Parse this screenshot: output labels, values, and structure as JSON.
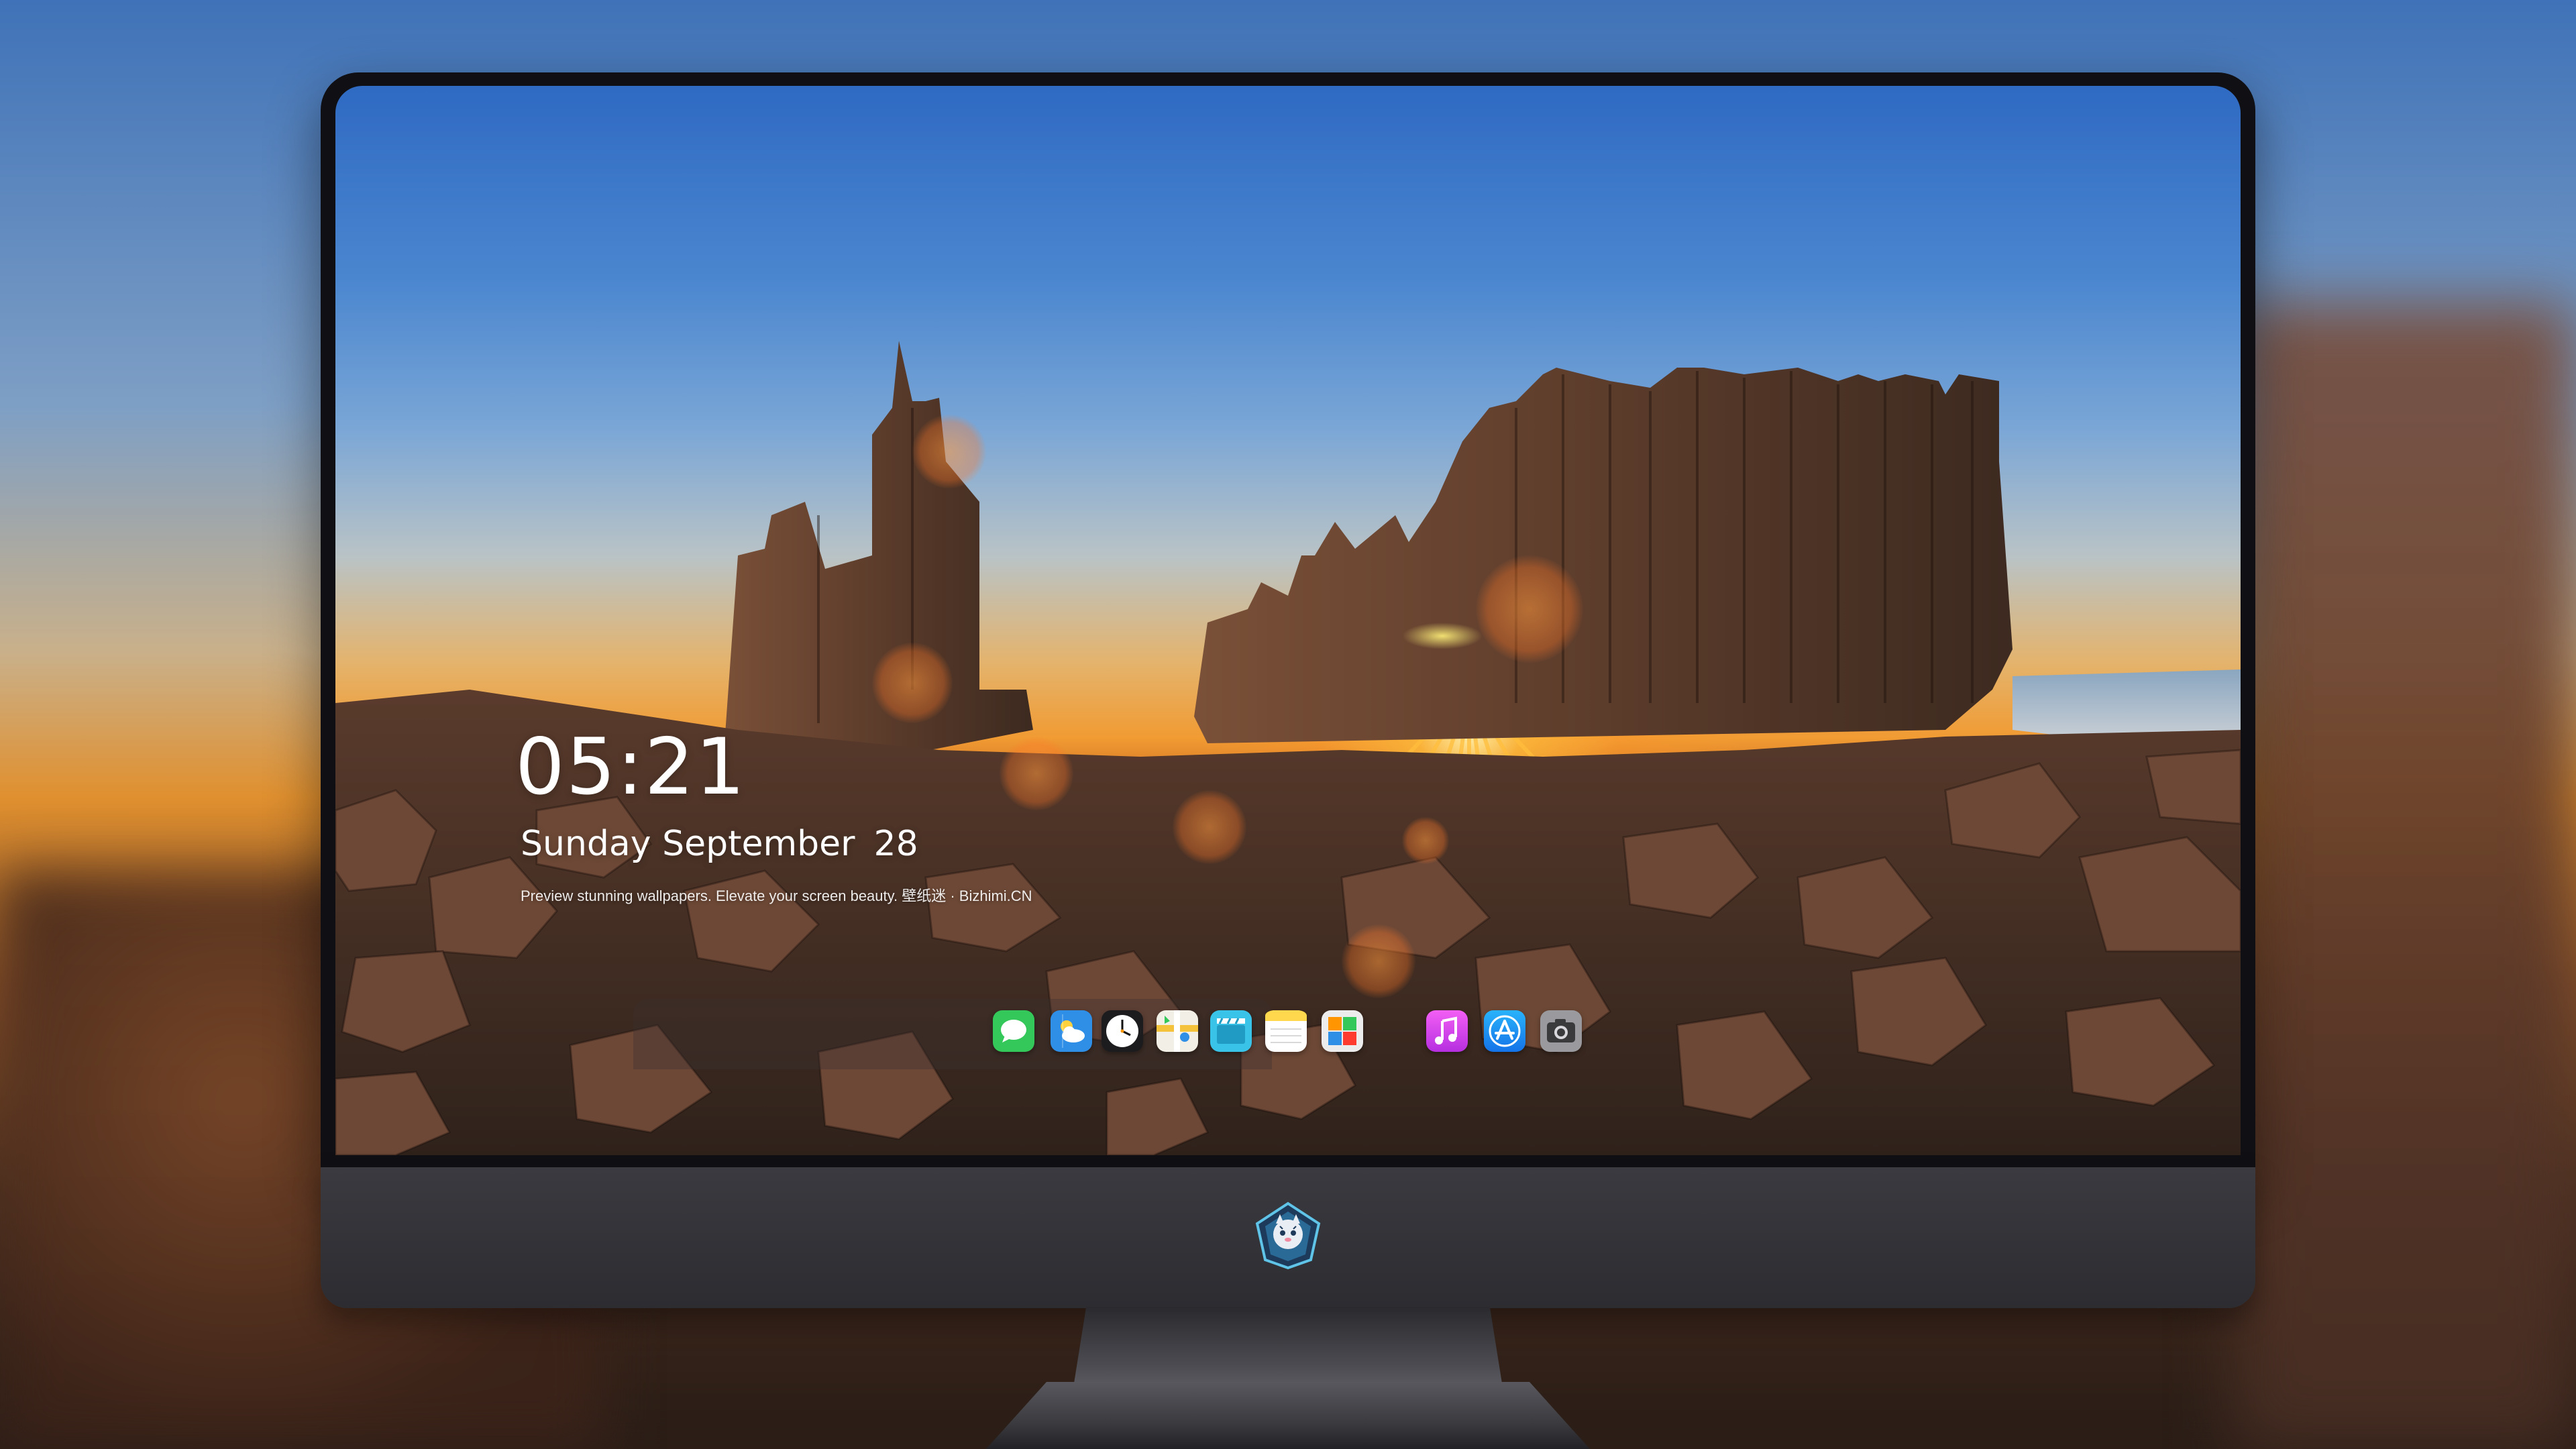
{
  "lockscreen": {
    "time": "05:21",
    "date_weekday_month": "Sunday September",
    "date_day": "28",
    "tagline": "Preview stunning wallpapers. Elevate your screen beauty. 壁纸迷 · Bizhimi.CN"
  },
  "dock": {
    "apps": [
      {
        "icon": "messages-icon",
        "color": "#34c759"
      },
      {
        "icon": "weather-icon",
        "color": "#2f8fe6"
      },
      {
        "icon": "clock-icon",
        "color": "#ffffff"
      },
      {
        "icon": "maps-icon",
        "color": "#f5c33b"
      },
      {
        "icon": "clips-icon",
        "color": "#39c3e8"
      },
      {
        "icon": "notes-icon",
        "color": "#ffd84d"
      },
      {
        "icon": "photos-icon",
        "color": "#e6e6e6"
      },
      {
        "icon": "music-icon",
        "color": "#e94ef0"
      },
      {
        "icon": "app-store-icon",
        "color": "#1e8cf5"
      },
      {
        "icon": "camera-icon",
        "color": "#8a8a8e"
      }
    ]
  },
  "branding": {
    "chin_logo_icon": "tiger-mascot-logo-icon"
  }
}
